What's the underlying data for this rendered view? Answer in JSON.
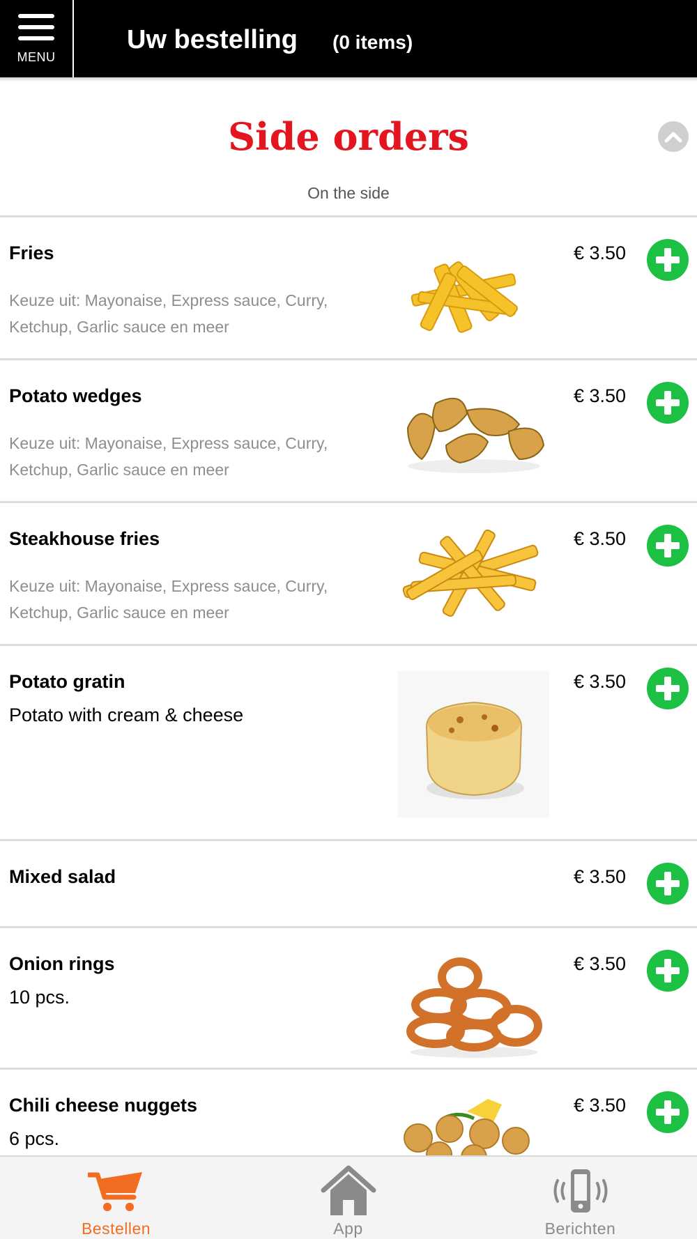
{
  "header": {
    "menu_label": "MENU",
    "title": "Uw bestelling",
    "item_count": "(0 items)"
  },
  "section": {
    "title": "Side orders",
    "subtitle": "On the side"
  },
  "items": [
    {
      "name": "Fries",
      "price": "€ 3.50",
      "description": "Keuze uit: Mayonaise, Express sauce, Curry, Ketchup, Garlic sauce en meer",
      "image": "crinkle-fries-image"
    },
    {
      "name": "Potato wedges",
      "price": "€ 3.50",
      "description": "Keuze uit: Mayonaise, Express sauce, Curry, Ketchup, Garlic sauce en meer",
      "image": "potato-wedges-image"
    },
    {
      "name": "Steakhouse fries",
      "price": "€ 3.50",
      "description": "Keuze uit: Mayonaise, Express sauce, Curry, Ketchup, Garlic sauce en meer",
      "image": "steakhouse-fries-image"
    },
    {
      "name": "Potato gratin",
      "price": "€ 3.50",
      "subtitle": "Potato with cream & cheese",
      "image": "potato-gratin-image"
    },
    {
      "name": "Mixed salad",
      "price": "€ 3.50"
    },
    {
      "name": "Onion rings",
      "price": "€ 3.50",
      "subtitle": "10 pcs.",
      "image": "onion-rings-image"
    },
    {
      "name": "Chili cheese nuggets",
      "price": "€ 3.50",
      "subtitle": "6 pcs.",
      "image": "chili-cheese-nuggets-image"
    }
  ],
  "bottom_nav": [
    {
      "label": "Bestellen",
      "icon": "cart-icon",
      "active": true
    },
    {
      "label": "App",
      "icon": "home-icon",
      "active": false
    },
    {
      "label": "Berichten",
      "icon": "phone-vibrate-icon",
      "active": false
    }
  ],
  "colors": {
    "header_bg": "#000000",
    "section_title": "#e3161f",
    "add_button": "#1cc042",
    "nav_active": "#f26c21",
    "nav_inactive": "#8a8a8a"
  }
}
